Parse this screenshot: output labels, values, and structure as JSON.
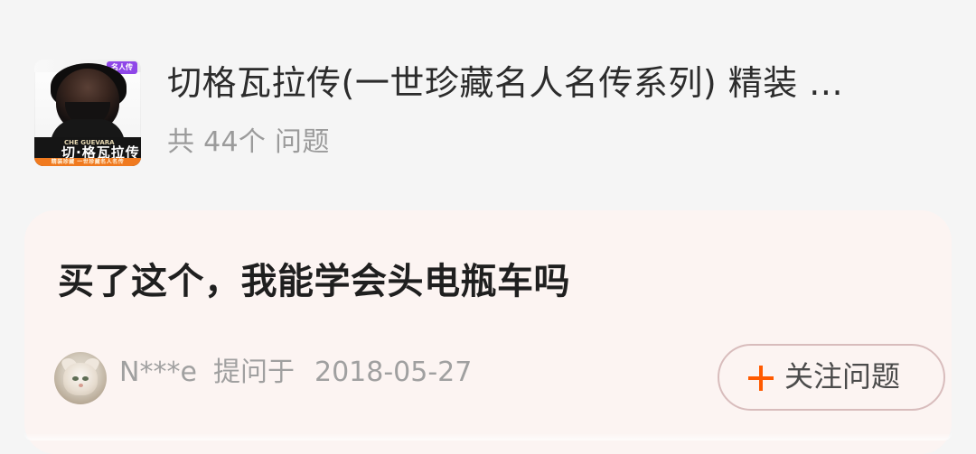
{
  "product": {
    "cover": {
      "tag": "名人传",
      "english_title": "CHE GUEVARA",
      "cover_title": "切·格瓦拉传",
      "strip_text": "精装珍藏 一世珍藏名人名传"
    },
    "title": "切格瓦拉传(一世珍藏名人名传系列) 精装 ...",
    "question_count": "共 44个 问题"
  },
  "question": {
    "text": "买了这个，我能学会头电瓶车吗",
    "asker_name": "N***e",
    "asked_prefix": "提问于",
    "asked_date": "2018-05-27",
    "follow_label": "关注问题"
  },
  "colors": {
    "background": "#f5f5f5",
    "card_background": "#fcf4f2",
    "accent": "#ff5a00",
    "muted_text": "#a0a0a0"
  }
}
